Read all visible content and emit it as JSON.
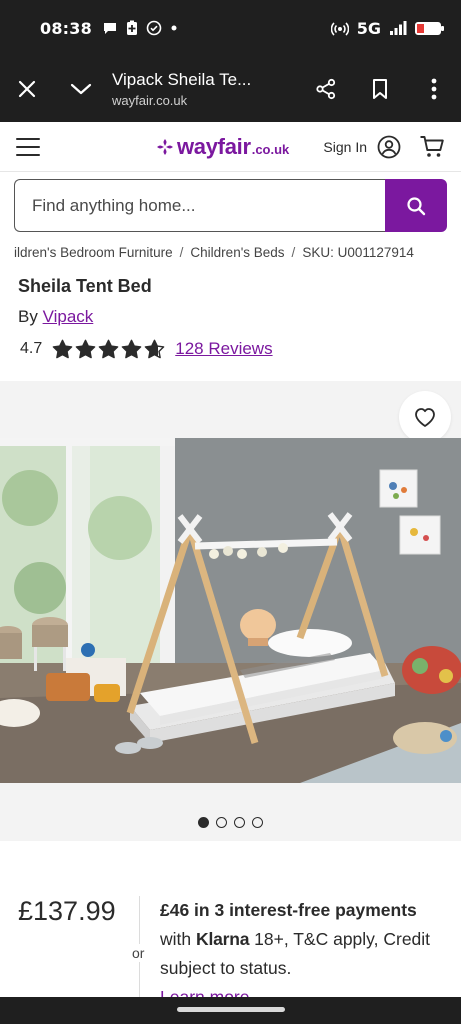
{
  "status_bar": {
    "time": "08:38",
    "network": "5G",
    "battery_level": 0.3
  },
  "browser": {
    "title": "Vipack Sheila Te...",
    "url": "wayfair.co.uk"
  },
  "site_header": {
    "logo_main": "wayfair",
    "logo_tld": ".co.uk",
    "sign_in_label": "Sign In"
  },
  "search": {
    "placeholder": "Find anything home..."
  },
  "breadcrumb": {
    "items": [
      "ildren's Bedroom Furniture",
      "Children's Beds"
    ],
    "sku": "SKU: U001127914"
  },
  "product": {
    "title": "Sheila Tent Bed",
    "by_label": "By",
    "brand": "Vipack",
    "rating": "4.7",
    "rating_value": 4.7,
    "reviews_label": "128 Reviews"
  },
  "gallery": {
    "image_count": 4,
    "active_index": 0
  },
  "pricing": {
    "price": "£137.99",
    "or_label": "or",
    "installment_amount": "£46 in 3 interest-free",
    "installment_payments": "payments",
    "installment_with": "with",
    "klarna": "Klarna",
    "terms": "18+, T&C apply, Credit subject to status.",
    "learn_more": "Learn more"
  },
  "colors": {
    "brand": "#7b189f",
    "text": "#2b2b2b",
    "chrome": "#1f1f1f"
  }
}
